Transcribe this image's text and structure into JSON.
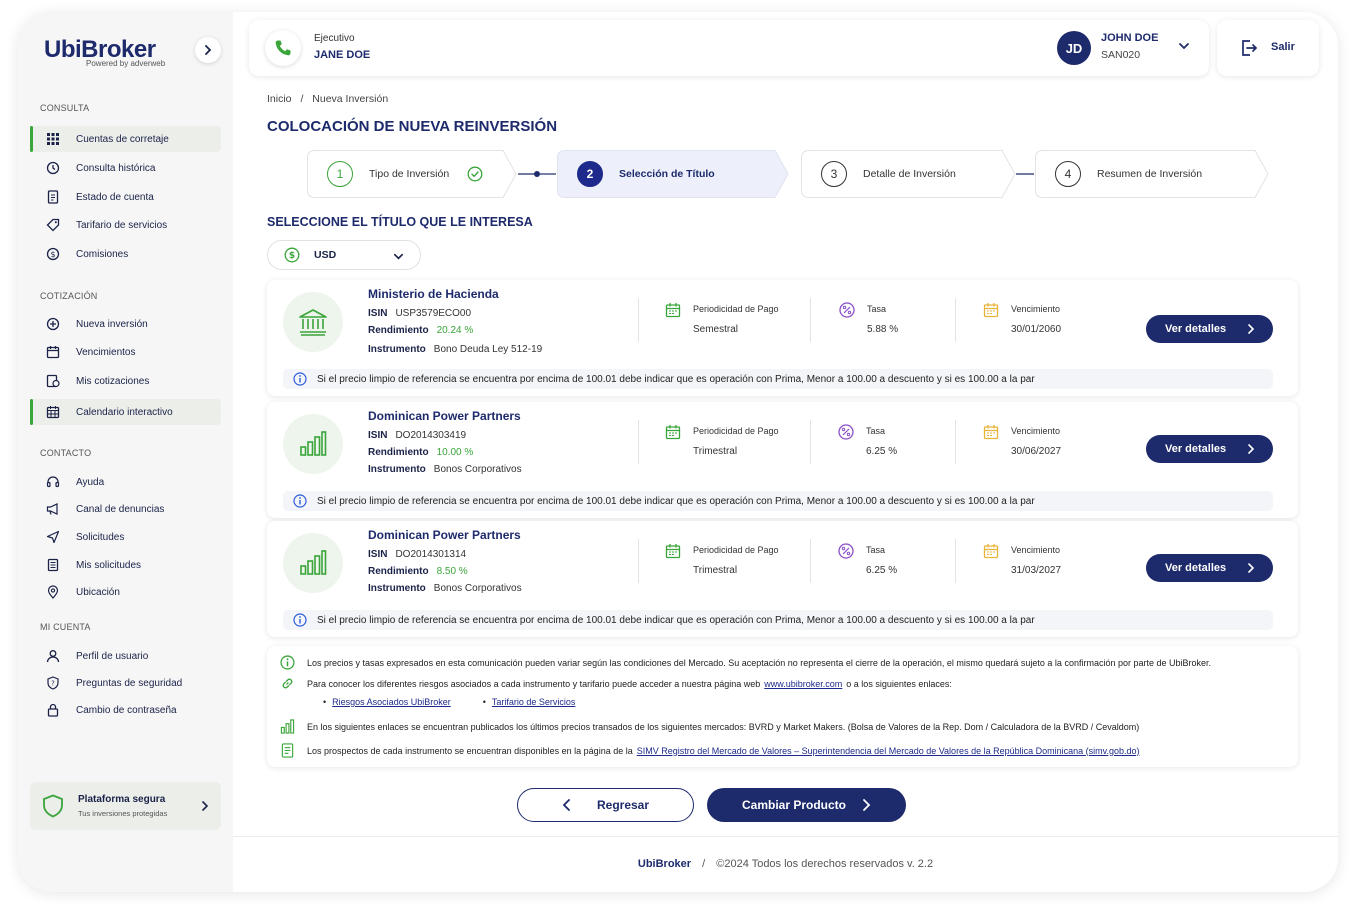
{
  "app": {
    "logo": "UbiBroker",
    "logo_sub": "Powered by adverweb"
  },
  "sidebar": {
    "sections": [
      {
        "title": "CONSULTA",
        "items": [
          {
            "label": "Cuentas de corretaje",
            "icon": "grid-icon",
            "active": true
          },
          {
            "label": "Consulta histórica",
            "icon": "history-icon"
          },
          {
            "label": "Estado de cuenta",
            "icon": "document-icon"
          },
          {
            "label": "Tarifario de servicios",
            "icon": "tag-icon"
          },
          {
            "label": "Comisiones",
            "icon": "coin-icon"
          }
        ]
      },
      {
        "title": "COTIZACIÓN",
        "items": [
          {
            "label": "Nueva inversión",
            "icon": "plus-circle-icon"
          },
          {
            "label": "Vencimientos",
            "icon": "calendar-icon"
          },
          {
            "label": "Mis cotizaciones",
            "icon": "quotes-icon"
          },
          {
            "label": "Calendario interactivo",
            "icon": "calendar-grid-icon",
            "active": true
          }
        ]
      },
      {
        "title": "CONTACTO",
        "items": [
          {
            "label": "Ayuda",
            "icon": "headset-icon"
          },
          {
            "label": "Canal de denuncias",
            "icon": "megaphone-icon"
          },
          {
            "label": "Solicitudes",
            "icon": "send-icon"
          },
          {
            "label": "Mis solicitudes",
            "icon": "list-icon"
          },
          {
            "label": "Ubicación",
            "icon": "location-icon"
          }
        ]
      },
      {
        "title": "MI CUENTA",
        "items": [
          {
            "label": "Perfil de usuario",
            "icon": "user-icon"
          },
          {
            "label": "Preguntas de seguridad",
            "icon": "shield-question-icon"
          },
          {
            "label": "Cambio de contraseña",
            "icon": "lock-icon"
          }
        ]
      }
    ],
    "secure": {
      "title": "Plataforma segura",
      "subtitle": "Tus inversiones protegidas"
    }
  },
  "header": {
    "exec_label": "Ejecutivo",
    "exec_name": "JANE DOE",
    "user_initials": "JD",
    "user_name": "JOHN DOE",
    "user_code": "SAN020",
    "logout_label": "Salir"
  },
  "breadcrumb": {
    "home": "Inicio",
    "sep": "/",
    "current": "Nueva Inversión"
  },
  "page_title": "COLOCACIÓN DE NUEVA REINVERSIÓN",
  "steps": [
    {
      "num": "1",
      "label": "Tipo de Inversión",
      "state": "done"
    },
    {
      "num": "2",
      "label": "Selección de Título",
      "state": "active"
    },
    {
      "num": "3",
      "label": "Detalle de Inversión",
      "state": "pending"
    },
    {
      "num": "4",
      "label": "Resumen de Inversión",
      "state": "pending"
    }
  ],
  "select_title": "SELECCIONE EL TÍTULO QUE LE INTERESA",
  "currency": "USD",
  "labels": {
    "isin": "ISIN",
    "rendimiento": "Rendimiento",
    "instrumento": "Instrumento",
    "periodicidad": "Periodicidad de Pago",
    "tasa": "Tasa",
    "vencimiento": "Vencimiento",
    "ver_detalles": "Ver detalles",
    "disclaimer": "Si el precio limpio de referencia se encuentra por encima de 100.01 debe indicar que es operación con Prima, Menor a 100.00 a descuento y si es 100.00 a la par"
  },
  "titles": [
    {
      "name": "Ministerio de Hacienda",
      "icon": "bank-icon",
      "isin": "USP3579ECO00",
      "rendimiento": "20.24 %",
      "instrumento": "Bono Deuda Ley 512-19",
      "periodicidad": "Semestral",
      "tasa": "5.88 %",
      "vencimiento": "30/01/2060"
    },
    {
      "name": "Dominican Power Partners",
      "icon": "bar-chart-icon",
      "isin": "DO2014303419",
      "rendimiento": "10.00 %",
      "instrumento": "Bonos Corporativos",
      "periodicidad": "Trimestral",
      "tasa": "6.25 %",
      "vencimiento": "30/06/2027"
    },
    {
      "name": "Dominican Power Partners",
      "icon": "bar-chart-icon",
      "isin": "DO2014301314",
      "rendimiento": "8.50 %",
      "instrumento": "Bonos Corporativos",
      "periodicidad": "Trimestral",
      "tasa": "6.25 %",
      "vencimiento": "31/03/2027"
    }
  ],
  "notes": {
    "n1": "Los precios y tasas expresados en esta comunicación pueden variar según las condiciones del Mercado. Su aceptación no representa el cierre de la operación, el mismo quedará sujeto a la confirmación por parte de UbiBroker.",
    "n2_pre": "Para conocer los diferentes riesgos asociados a cada instrumento y tarifario puede acceder a nuestra página web",
    "n2_link": "www.ubibroker.com",
    "n2_post": "o a los siguientes enlaces:",
    "link1": "Riesgos Asociados UbiBroker",
    "link2": "Tarifario de Servicios",
    "n3": "En los siguientes enlaces se encuentran publicados los últimos precios transados de los siguientes mercados: BVRD y Market Makers. (Bolsa de Valores de la Rep. Dom / Calculadora de la BVRD / Cevaldom)",
    "n4_pre": "Los prospectos de cada instrumento se encuentran disponibles en la página de la",
    "n4_link": "SIMV Registro del Mercado de Valores – Superintendencia del Mercado de Valores de la República Dominicana (simv.gob.do)"
  },
  "actions": {
    "back": "Regresar",
    "change": "Cambiar Producto"
  },
  "footer": {
    "brand": "UbiBroker",
    "sep": "/",
    "text": "©2024 Todos los derechos reservados v. 2.2"
  },
  "colors": {
    "primary": "#1d2a6b",
    "accent_green": "#3aa53a",
    "info_blue": "#2a5bd7",
    "purple": "#8a4fc7",
    "yellow": "#e8b43a"
  }
}
